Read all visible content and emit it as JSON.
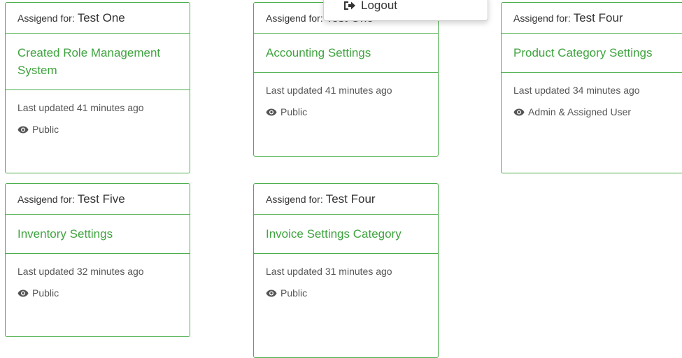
{
  "menu": {
    "logout_label": "Logout"
  },
  "cards": [
    {
      "assigned_label": "Assigend for:",
      "assigned_name": "Test One",
      "title": "Created Role Management System",
      "updated": "Last updated 41 minutes ago",
      "visibility": "Public"
    },
    {
      "assigned_label": "Assigend for:",
      "assigned_name": "Test One",
      "title": "Accounting Settings",
      "updated": "Last updated 41 minutes ago",
      "visibility": "Public"
    },
    {
      "assigned_label": "Assigend for:",
      "assigned_name": "Test Four",
      "title": "Product Category Settings",
      "updated": "Last updated 34 minutes ago",
      "visibility": "Admin & Assigned User"
    },
    {
      "assigned_label": "Assigend for:",
      "assigned_name": "Test Five",
      "title": "Inventory Settings",
      "updated": "Last updated 32 minutes ago",
      "visibility": "Public"
    },
    {
      "assigned_label": "Assigend for:",
      "assigned_name": "Test Four",
      "title": "Invoice Settings Category",
      "updated": "Last updated 31 minutes ago",
      "visibility": "Public"
    }
  ],
  "colors": {
    "accent_green": "#3fa33f",
    "border_green": "#4cae4c"
  },
  "icons": {
    "visibility": "eye-icon",
    "logout": "sign-out-icon"
  }
}
